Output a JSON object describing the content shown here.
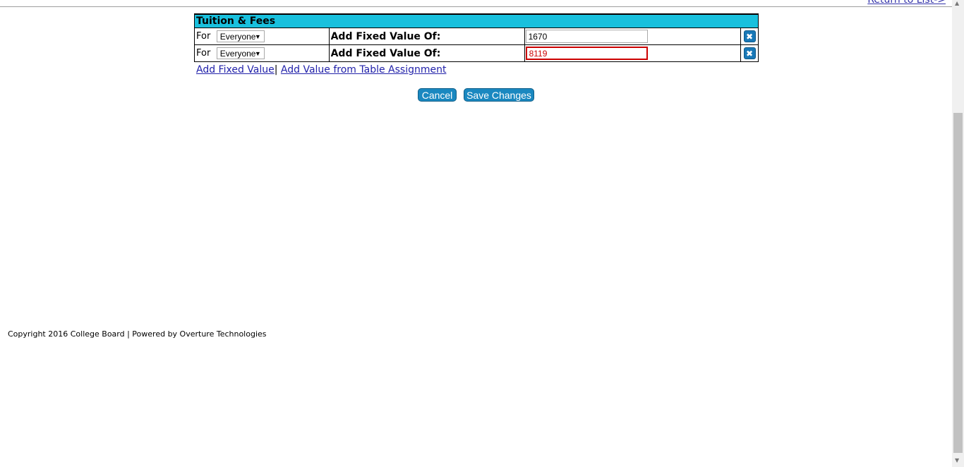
{
  "header": {
    "return_link": "Return to List->"
  },
  "fees_table": {
    "title": "Tuition & Fees",
    "rows": [
      {
        "for_label": "For",
        "selected": "Everyone",
        "label": "Add Fixed Value Of:",
        "value": "1670",
        "error": false
      },
      {
        "for_label": "For",
        "selected": "Everyone",
        "label": "Add Fixed Value Of:",
        "value": "8119",
        "error": true
      }
    ],
    "remove_icon": "close-icon"
  },
  "links": {
    "add_fixed": "Add Fixed Value",
    "separator": "|",
    "add_from_table": "Add Value from Table Assignment"
  },
  "actions": {
    "cancel": "Cancel",
    "save": "Save Changes",
    "button_color": "#1a88c0"
  },
  "footer": {
    "copyright": "Copyright 2016 College Board | Powered by Overture Technologies"
  },
  "colors": {
    "header_bg": "#19c0dd",
    "error": "#cc0000",
    "link": "#2222aa"
  }
}
